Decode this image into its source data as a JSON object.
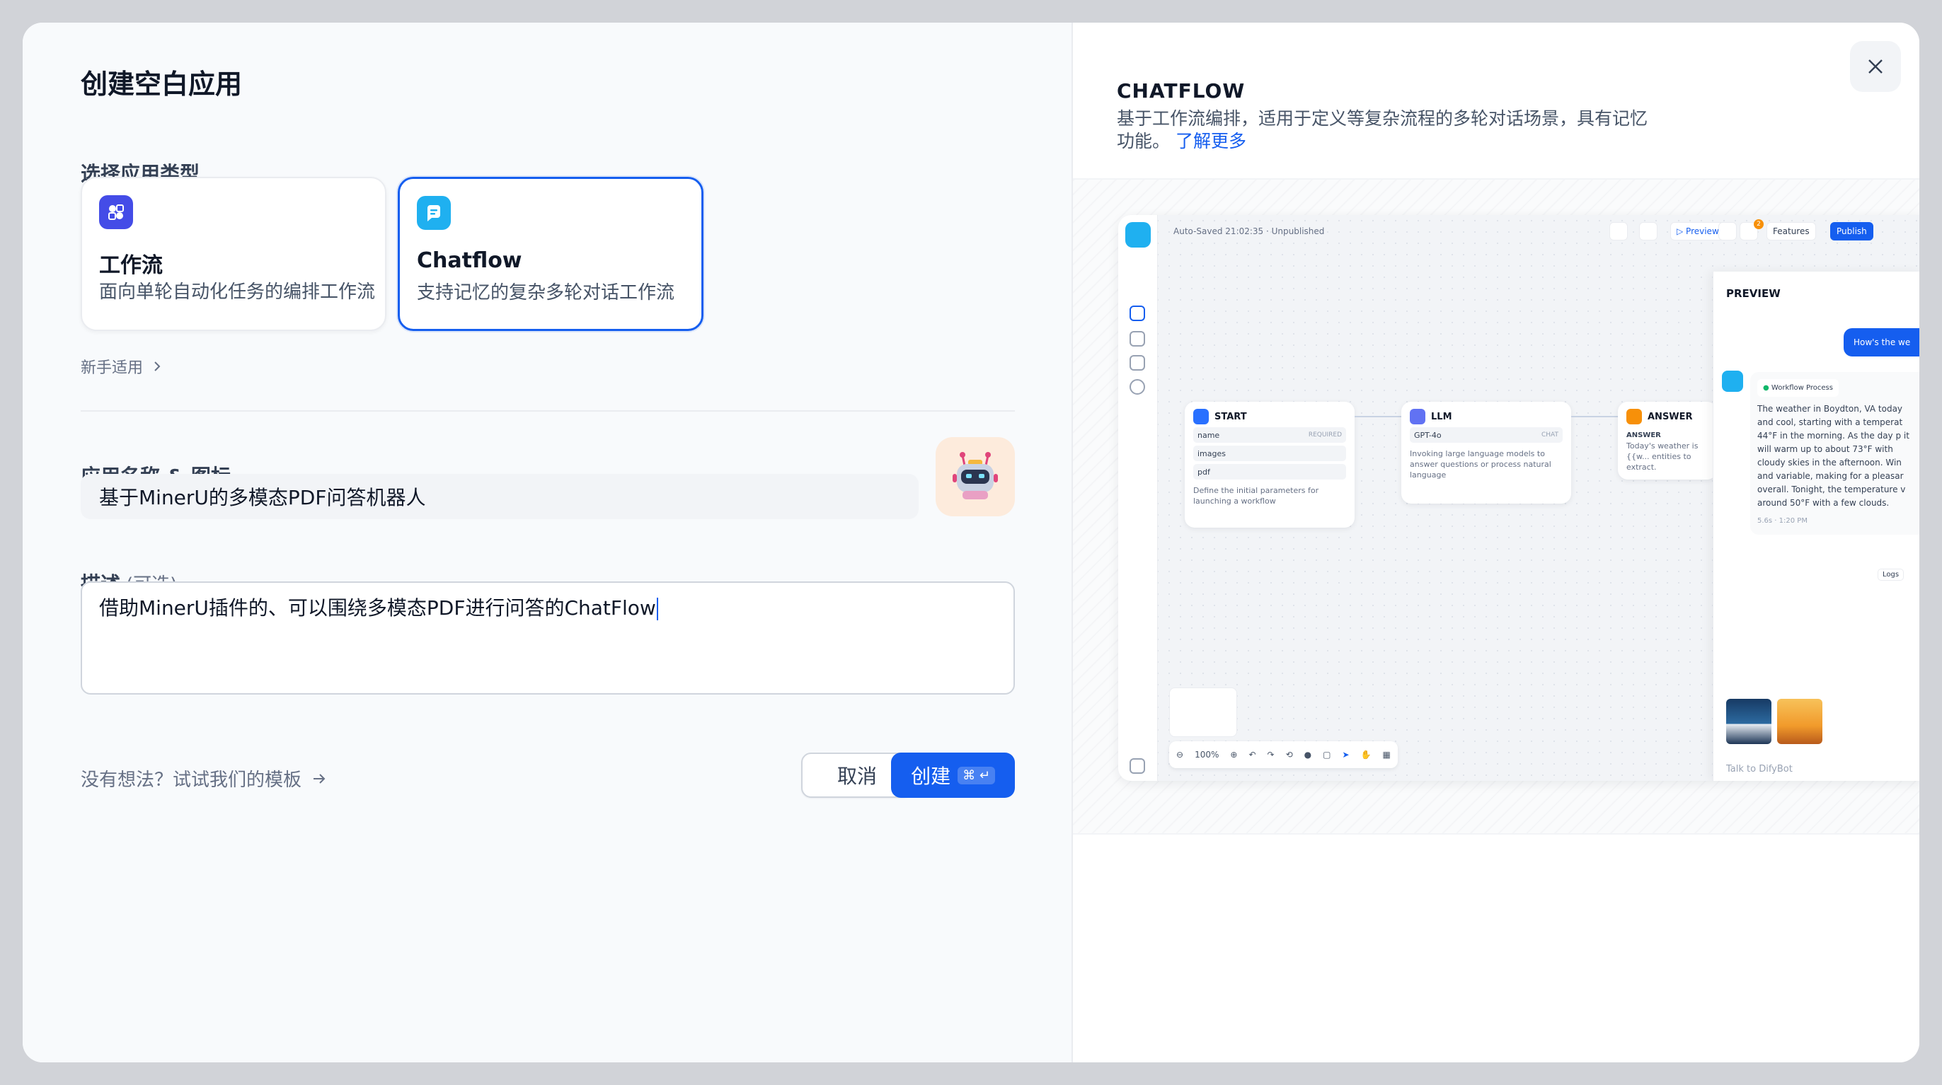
{
  "dialog": {
    "title": "创建空白应用",
    "section_type": "选择应用类型",
    "app_types": [
      {
        "title": "工作流",
        "desc": "面向单轮自动化任务的编排工作流",
        "icon": "workflow-icon"
      },
      {
        "title": "Chatflow",
        "desc": "支持记忆的复杂多轮对话工作流",
        "icon": "chatflow-icon"
      }
    ],
    "beginner_link": "新手适用",
    "section_name": "应用名称 & 图标",
    "name_value": "基于MinerU的多模态PDF问答机器人",
    "section_desc": "描述",
    "desc_optional": "(可选)",
    "desc_value": "借助MinerU插件的、可以围绕多模态PDF进行问答的ChatFlow",
    "template_link": "没有想法？试试我们的模板",
    "cancel_label": "取消",
    "create_label": "创建",
    "create_kbd": "⌘ ↵"
  },
  "detail": {
    "title": "CHATFLOW",
    "desc": "基于工作流编排，适用于定义等复杂流程的多轮对话场景，具有记忆功能。",
    "learn_more": "了解更多"
  },
  "preview": {
    "topbar_status": "Auto-Saved 21:02:35 · Unpublished",
    "btn_preview": "Preview",
    "btn_features": "Features",
    "btn_publish": "Publish",
    "badge_count": "2",
    "nodes": {
      "start": {
        "title": "START",
        "fields": [
          "name",
          "images",
          "pdf"
        ],
        "required": "REQUIRED",
        "desc": "Define the initial parameters for launching a workflow"
      },
      "llm": {
        "title": "LLM",
        "model": "GPT-4o",
        "mode": "CHAT",
        "desc": "Invoking large language models to answer questions or process natural language"
      },
      "answer": {
        "title": "ANSWER",
        "label": "ANSWER",
        "desc": "Today's weather is {{w... entities to extract."
      }
    },
    "panel_title": "PREVIEW",
    "user_msg": "How's the we",
    "workflow_chip": "Workflow Process",
    "bot_msg": "The weather in Boydton, VA today and cool, starting with a temperat 44°F in the morning. As the day p it will warm up to about 73°F with cloudy skies in the afternoon. Win and variable, making for a pleasar overall. Tonight, the temperature v around 50°F with a few clouds.",
    "msg_meta": "5.6s · 1:20 PM",
    "logs": "Logs",
    "input_placeholder": "Talk to DifyBot",
    "zoom": "100%"
  },
  "colors": {
    "accent": "#155eef",
    "workflow_icon": "#444ce7",
    "chatflow_icon": "#1fb0f0"
  }
}
